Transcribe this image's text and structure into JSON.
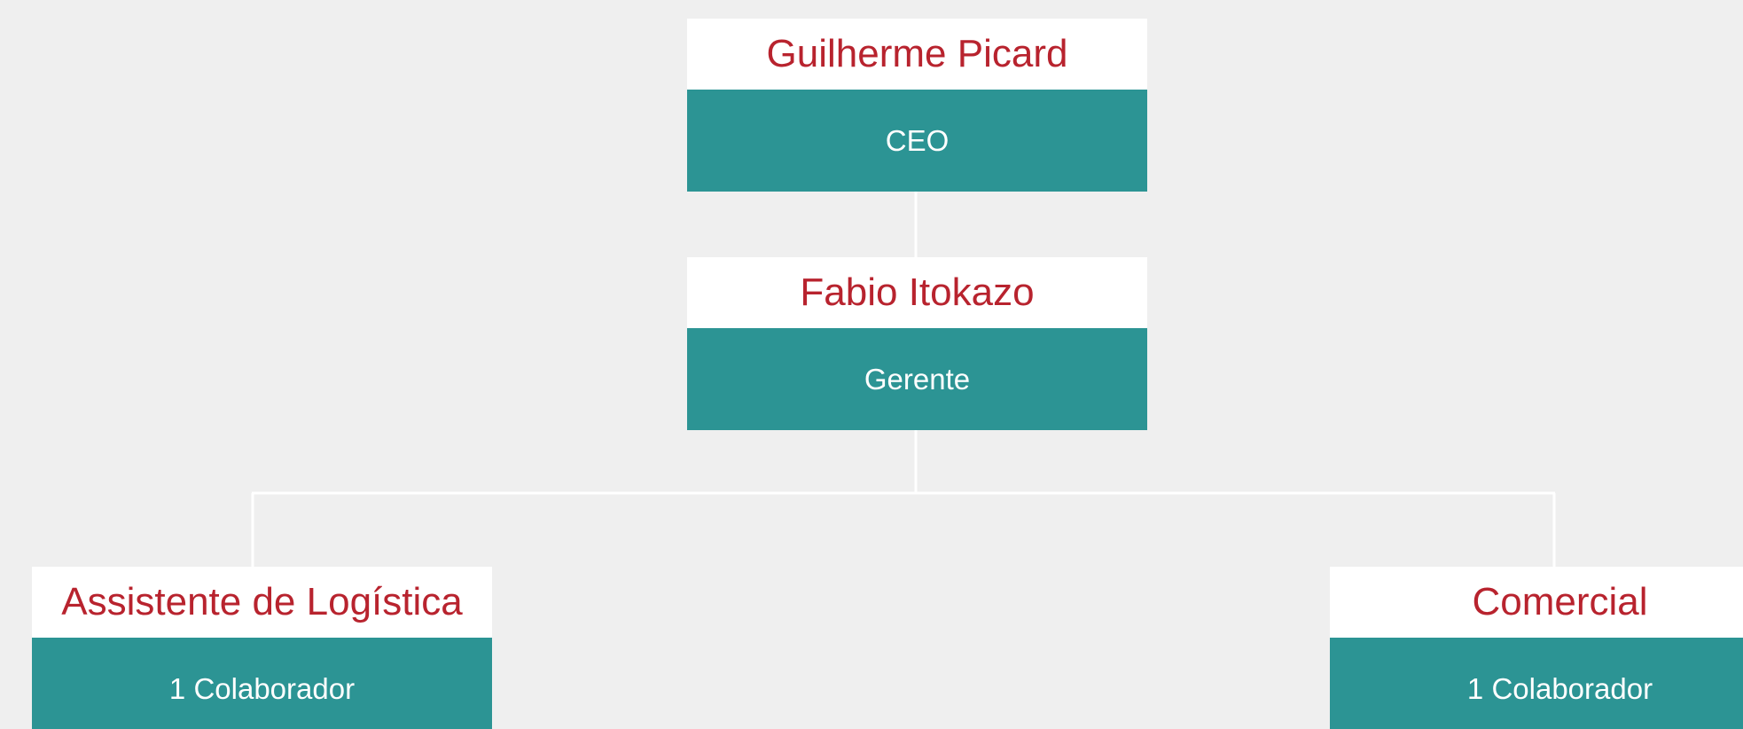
{
  "colors": {
    "background": "#efefef",
    "name_text": "#b8232e",
    "role_band": "#2c9494",
    "role_text": "#ffffff",
    "connector": "#ffffff"
  },
  "org_chart": {
    "ceo": {
      "name": "Guilherme Picard",
      "role": "CEO"
    },
    "manager": {
      "name": "Fabio Itokazo",
      "role": "Gerente"
    },
    "logistics": {
      "name": "Assistente de Logística",
      "role": "1 Colaborador"
    },
    "commercial": {
      "name": "Comercial",
      "role": "1 Colaborador"
    }
  }
}
